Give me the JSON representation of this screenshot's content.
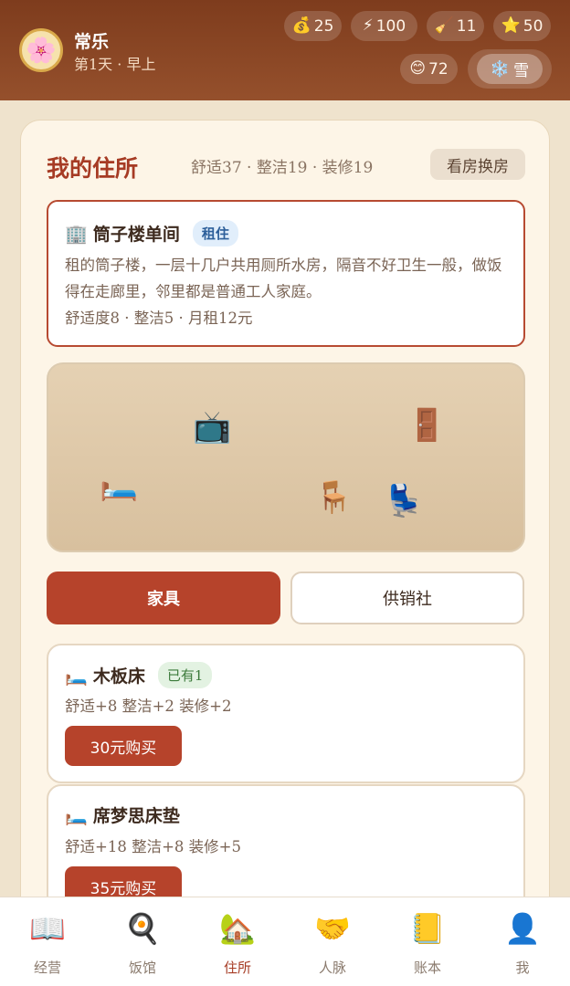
{
  "header": {
    "avatar_icon": "🌸",
    "name": "常乐",
    "subtitle": "第1天 · 早上",
    "stats": [
      {
        "icon": "💰",
        "name": "money-icon",
        "value": "25"
      },
      {
        "icon": "⚡",
        "name": "energy-icon",
        "value": "100"
      },
      {
        "icon": "🧹",
        "name": "tool-icon",
        "value": "11"
      },
      {
        "icon": "⭐",
        "name": "star-icon",
        "value": "50"
      }
    ],
    "mood": {
      "icon": "😊",
      "value": "72"
    },
    "weather": {
      "icon": "❄️",
      "label": "雪"
    }
  },
  "residence": {
    "title": "我的住所",
    "stats": "舒适37 · 整洁19 · 装修19",
    "switch_button": "看房换房",
    "house": {
      "icon": "🏢",
      "name": "筒子楼单间",
      "badge": "租住",
      "description": "租的筒子楼，一层十几户共用厕所水房，隔音不好卫生一般，做饭得在走廊里，邻里都是普通工人家庭。",
      "meta": "舒适度8 · 整洁5 · 月租12元"
    },
    "room_items": [
      "📺",
      "🚪",
      "🛏️",
      "🪑",
      "💺"
    ]
  },
  "tabs": {
    "furniture": "家具",
    "shop": "供销社"
  },
  "items": [
    {
      "icon": "🛏️",
      "name": "木板床",
      "badge": "已有1",
      "stats": "舒适+8 整洁+2 装修+2",
      "button": "30元购买"
    },
    {
      "icon": "🛏️",
      "name": "席梦思床垫",
      "badge": "",
      "stats": "舒适+18 整洁+8 装修+5",
      "button": "35元购买"
    }
  ],
  "nav": [
    {
      "icon": "📖",
      "label": "经营"
    },
    {
      "icon": "🍳",
      "label": "饭馆"
    },
    {
      "icon": "🏡",
      "label": "住所"
    },
    {
      "icon": "🤝",
      "label": "人脉"
    },
    {
      "icon": "📒",
      "label": "账本"
    },
    {
      "icon": "👤",
      "label": "我"
    }
  ]
}
